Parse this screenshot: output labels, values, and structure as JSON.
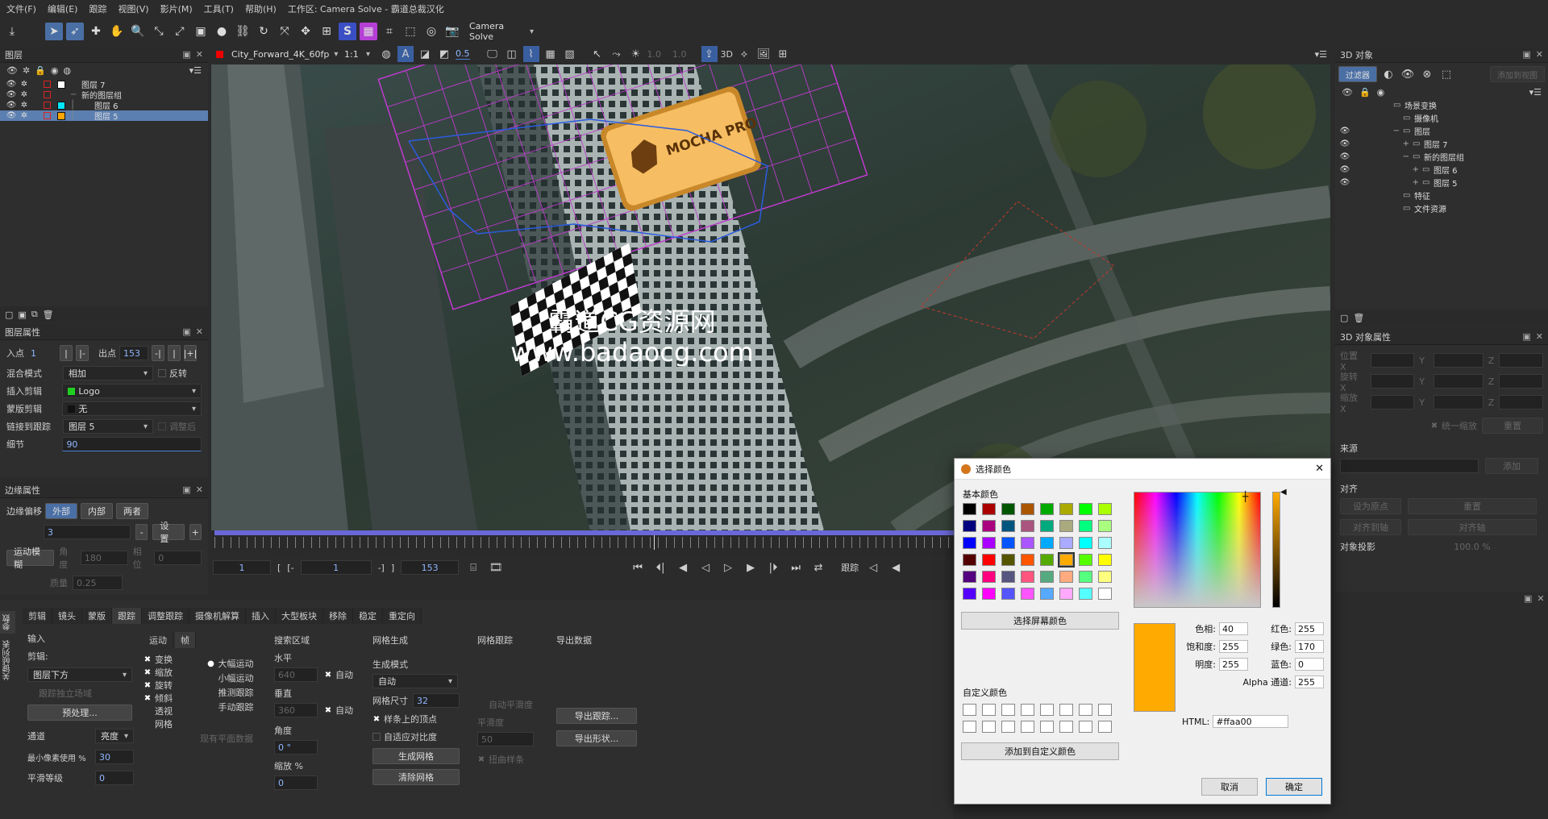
{
  "menu": [
    "文件(F)",
    "编辑(E)",
    "跟踪",
    "视图(V)",
    "影片(M)",
    "工具(T)",
    "帮助(H)"
  ],
  "window_title": "工作区: Camera Solve - 霸道总裁汉化",
  "workspace_select": "Camera Solve",
  "clip_select": "City_Forward_4K_60fp",
  "zoom_select": "1:1",
  "opacity_value": "0.5",
  "view_values": {
    "a": "1.0",
    "b": "1.0"
  },
  "view_3d_label": "3D",
  "layers_panel": {
    "title": "图层",
    "items": [
      {
        "name": "图层 7",
        "color": "#ffffff",
        "indent": 0
      },
      {
        "name": "新的图层组",
        "color": "",
        "indent": 0
      },
      {
        "name": "图层 6",
        "color": "#00e5ff",
        "indent": 1
      },
      {
        "name": "图层 5",
        "color": "#ffa500",
        "indent": 1
      }
    ]
  },
  "layer_props": {
    "title": "图层属性",
    "in_label": "入点",
    "in_value": "1",
    "out_label": "出点",
    "out_value": "153",
    "blend_label": "混合模式",
    "blend_value": "相加",
    "invert_label": "反转",
    "insert_label": "插入剪辑",
    "insert_value": "Logo",
    "matte_label": "蒙版剪辑",
    "matte_value": "无",
    "link_label": "链接到跟踪",
    "link_value": "图层 5",
    "adjust_label": "调整后",
    "detail_label": "细节",
    "detail_value": "90"
  },
  "edge_props": {
    "title": "边缘属性",
    "offset_label": "边缘偏移",
    "tabs": [
      "外部",
      "内部",
      "两者"
    ],
    "offset_value": "3",
    "set_label": "设置",
    "motion_blur_label": "运动模糊",
    "angle_label": "角度",
    "angle_value": "180",
    "phase_label": "相位",
    "phase_value": "0",
    "quality_label": "质量",
    "quality_value": "0.25"
  },
  "overlay_text": {
    "line1": "霸道CG资源网",
    "line2": "www.badaocg.com",
    "logo": "MOCHA PRO"
  },
  "timeline": {
    "in": "1",
    "current": "1",
    "out": "153",
    "track_label": "跟踪"
  },
  "bottom_tabs": [
    "剪辑",
    "镜头",
    "蒙版",
    "跟踪",
    "调整跟踪",
    "摄像机解算",
    "插入",
    "大型板块",
    "移除",
    "稳定",
    "重定向"
  ],
  "side_tabs": [
    "参数",
    "关键帧列表"
  ],
  "track_params": {
    "input_label": "输入",
    "clip_label": "剪辑:",
    "clip_value": "图层下方",
    "track_separate_label": "跟踪独立场域",
    "preprocess_label": "预处理...",
    "channel_label": "通道",
    "channel_value": "亮度",
    "min_pixel_label": "最小像素使用 %",
    "min_pixel_value": "30",
    "smooth_label": "平滑等级",
    "smooth_value": "0",
    "motion_label": "运动",
    "frame_label": "帧",
    "motion_checks": [
      "变换",
      "缩放",
      "旋转",
      "倾斜",
      "透视",
      "网格"
    ],
    "motion_radios": [
      "大幅运动",
      "小幅运动",
      "推测跟踪",
      "手动跟踪"
    ],
    "existing_plane_label": "现有平面数据",
    "search_label": "搜索区域",
    "horiz_label": "水平",
    "horiz_value": "640",
    "auto_label": "自动",
    "vert_label": "垂直",
    "vert_value": "360",
    "angle_label": "角度",
    "angle_value": "0 °",
    "scale_label": "缩放 %",
    "scale_value": "0",
    "mesh_gen_label": "网格生成",
    "gen_mode_label": "生成模式",
    "gen_mode_value": "自动",
    "mesh_size_label": "网格尺寸",
    "mesh_size_value": "32",
    "snap_label": "样条上的顶点",
    "adaptive_label": "自适应对比度",
    "gen_mesh_label": "生成网格",
    "clear_mesh_label": "清除网格",
    "mesh_track_label": "网格跟踪",
    "auto_smooth_label": "自动平滑度",
    "smooth2_label": "平滑度",
    "smooth2_value": "50",
    "warp_label": "扭曲样条",
    "export_label": "导出数据",
    "export_track_label": "导出跟踪...",
    "export_shape_label": "导出形状..."
  },
  "obj3d_panel": {
    "title": "3D 对象",
    "filter_label": "过滤器",
    "add_label": "添加到视图",
    "tree": [
      {
        "name": "场景变换",
        "indent": 0,
        "eye": false
      },
      {
        "name": "摄像机",
        "indent": 1,
        "eye": false
      },
      {
        "name": "图层",
        "indent": 1,
        "eye": true
      },
      {
        "name": "图层 7",
        "indent": 2,
        "eye": true
      },
      {
        "name": "新的图层组",
        "indent": 2,
        "eye": true
      },
      {
        "name": "图层 6",
        "indent": 3,
        "eye": true
      },
      {
        "name": "图层 5",
        "indent": 3,
        "eye": true
      },
      {
        "name": "特征",
        "indent": 1,
        "eye": false
      },
      {
        "name": "文件资源",
        "indent": 1,
        "eye": false
      }
    ]
  },
  "obj3d_props": {
    "title": "3D 对象属性",
    "pos_label": "位置 X",
    "rot_label": "旋转 X",
    "scale_label": "缩放 X",
    "y_label": "Y",
    "z_label": "Z",
    "uniform_label": "统一缩放",
    "reset_label": "重置",
    "source_label": "来源",
    "add_btn": "添加",
    "align_label": "对齐",
    "set_origin": "设为原点",
    "reset2": "重置",
    "align_axis": "对齐到轴",
    "align_btn": "对齐轴",
    "shadow_label": "对象投影",
    "shadow_value": "100.0 %"
  },
  "color_dialog": {
    "title": "选择颜色",
    "basic_label": "基本颜色",
    "pick_screen": "选择屏幕颜色",
    "custom_label": "自定义颜色",
    "add_custom": "添加到自定义颜色",
    "hue_label": "色相:",
    "hue_value": "40",
    "sat_label": "饱和度:",
    "sat_value": "255",
    "val_label": "明度:",
    "val_value": "255",
    "red_label": "红色:",
    "red_value": "255",
    "green_label": "绿色:",
    "green_value": "170",
    "blue_label": "蓝色:",
    "blue_value": "0",
    "alpha_label": "Alpha 通道:",
    "alpha_value": "255",
    "html_label": "HTML:",
    "html_value": "#ffaa00",
    "cancel_label": "取消",
    "ok_label": "确定",
    "current_color": "#ffaa00",
    "basic_colors": [
      "#000000",
      "#aa0000",
      "#005500",
      "#aa5500",
      "#00aa00",
      "#aaaa00",
      "#00ff00",
      "#aaff00",
      "#00007f",
      "#aa007f",
      "#00557f",
      "#aa557f",
      "#00aa7f",
      "#aaaa7f",
      "#00ff7f",
      "#aaff7f",
      "#0000ff",
      "#aa00ff",
      "#0055ff",
      "#aa55ff",
      "#00aaff",
      "#aaaaff",
      "#00ffff",
      "#aaffff",
      "#550000",
      "#ff0000",
      "#555500",
      "#ff5500",
      "#55aa00",
      "#ffaa00",
      "#55ff00",
      "#ffff00",
      "#55007f",
      "#ff007f",
      "#55557f",
      "#ff557f",
      "#55aa7f",
      "#ffaa7f",
      "#55ff7f",
      "#ffff7f",
      "#5500ff",
      "#ff00ff",
      "#5555ff",
      "#ff55ff",
      "#55aaff",
      "#ffaaff",
      "#55ffff",
      "#ffffff"
    ]
  }
}
